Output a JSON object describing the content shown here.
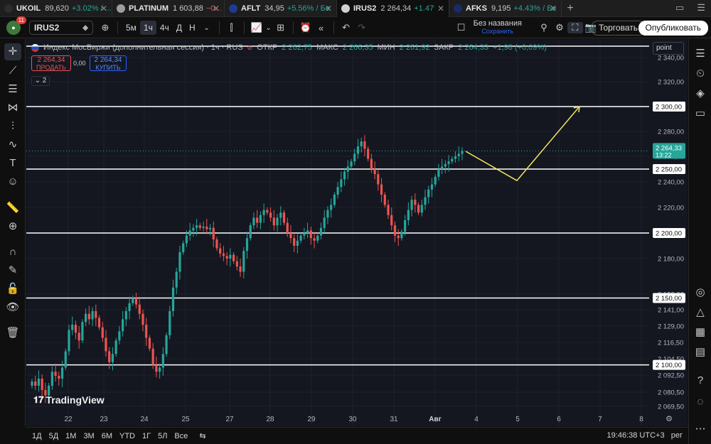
{
  "tabs": [
    {
      "symbol": "UKOIL",
      "price": "89,620",
      "change": "+3.02% / ...",
      "dir": "up",
      "flag": "#2c2c2c"
    },
    {
      "symbol": "PLATINUM",
      "price": "1 603,88",
      "change": "−0...",
      "dir": "down",
      "flag": "#9e9e9e"
    },
    {
      "symbol": "AFLT",
      "price": "34,95",
      "change": "+5.56% / Бе",
      "dir": "up",
      "flag": "#1f3a93"
    },
    {
      "symbol": "IRUS2",
      "price": "2 264,34",
      "change": "+1.47%",
      "dir": "up",
      "flag": "#d0d0d0",
      "active": true
    },
    {
      "symbol": "AFKS",
      "price": "9,195",
      "change": "+4.43% / Бе",
      "dir": "up",
      "flag": "#1a2b6b"
    }
  ],
  "toolbar": {
    "badge": "11",
    "symbol": "IRUS2",
    "intervals": [
      "5м",
      "1ч",
      "4ч",
      "Д",
      "Н"
    ],
    "selected_interval": "1ч",
    "layout_name": "Без названия",
    "layout_sub": "Сохранить",
    "trade": "Торговать",
    "publish": "Опубликовать"
  },
  "legend": {
    "title": "Индекс МосБиржи (дополнительная сессия) · 1ч · RUS",
    "open_k": "ОТКР",
    "open_v": "2 262,75",
    "high_k": "МАКС",
    "high_v": "2 266,35",
    "low_k": "МИН",
    "low_v": "2 261,92",
    "close_k": "ЗАКР",
    "close_v": "2 264,33",
    "chg": "+1,98 (+0,09%)"
  },
  "trade_panel": {
    "sell_price": "2 264,34",
    "sell_label": "ПРОДАТЬ",
    "spread": "0,00",
    "buy_price": "2 264,34",
    "buy_label": "КУПИТЬ",
    "indicators_count": "2"
  },
  "point_label": "point",
  "logo": "TradingView",
  "chart_data": {
    "type": "candlestick",
    "y_ticks": [
      2069.5,
      2080.5,
      2092.5,
      2104.5,
      2116.5,
      2129,
      2141,
      2153,
      2180,
      2200,
      2220,
      2240,
      2260,
      2280,
      2300,
      2320,
      2340
    ],
    "y_tick_labels": [
      "2 069,50",
      "2 080,50",
      "2 092,50",
      "2 104,50",
      "2 116,50",
      "2 129,00",
      "2 141,00",
      "2 153,00",
      "2 180,00",
      "2 200,00",
      "2 220,00",
      "2 240,00",
      "2 260,00",
      "2 280,00",
      "2 300,00",
      "2 320,00",
      "2 340,00"
    ],
    "x_labels": [
      "22",
      "23",
      "24",
      "25",
      "27",
      "28",
      "29",
      "30",
      "31",
      "Авг",
      "4",
      "5",
      "6",
      "7",
      "8"
    ],
    "horizontal_levels": [
      {
        "value": 2100,
        "label": "2 100,00"
      },
      {
        "value": 2150,
        "label": "2 150,00"
      },
      {
        "value": 2200,
        "label": "2 200,00"
      },
      {
        "value": 2250,
        "label": "2 250,00"
      },
      {
        "value": 2300,
        "label": "2 300,00"
      },
      {
        "value": 2342,
        "label": ""
      }
    ],
    "last_price": {
      "value": 2264.33,
      "label": "2 264,33",
      "countdown": "13:22"
    },
    "closes": [
      2088,
      2085,
      2090,
      2082,
      2078,
      2085,
      2095,
      2092,
      2090,
      2098,
      2110,
      2126,
      2130,
      2124,
      2118,
      2132,
      2138,
      2134,
      2140,
      2135,
      2128,
      2120,
      2110,
      2102,
      2108,
      2118,
      2125,
      2134,
      2140,
      2146,
      2150,
      2145,
      2138,
      2130,
      2120,
      2112,
      2100,
      2095,
      2098,
      2108,
      2122,
      2140,
      2158,
      2170,
      2185,
      2192,
      2198,
      2202,
      2204,
      2206,
      2204,
      2205,
      2203,
      2204,
      2195,
      2188,
      2184,
      2182,
      2180,
      2183,
      2178,
      2174,
      2170,
      2186,
      2196,
      2206,
      2212,
      2208,
      2214,
      2218,
      2216,
      2212,
      2206,
      2212,
      2216,
      2208,
      2200,
      2196,
      2190,
      2194,
      2198,
      2200,
      2202,
      2196,
      2194,
      2198,
      2204,
      2212,
      2218,
      2222,
      2230,
      2236,
      2242,
      2248,
      2252,
      2256,
      2262,
      2268,
      2272,
      2266,
      2258,
      2250,
      2246,
      2238,
      2230,
      2222,
      2214,
      2206,
      2198,
      2196,
      2201,
      2210,
      2218,
      2226,
      2222,
      2216,
      2222,
      2228,
      2234,
      2238,
      2244,
      2250,
      2252,
      2254,
      2256,
      2258,
      2260,
      2262,
      2264.33
    ],
    "opens_offset_pct": 0.5,
    "projection": [
      {
        "x_index": 128,
        "value": 2264
      },
      {
        "x_index": 146,
        "value": 2241
      },
      {
        "x_index": 168,
        "value": 2300
      }
    ]
  },
  "bottombar": {
    "ranges": [
      "1Д",
      "5Д",
      "1М",
      "3М",
      "6М",
      "YTD",
      "1Г",
      "5Л",
      "Все"
    ],
    "time": "19:46:38 UTC+3",
    "mode": "рег"
  }
}
